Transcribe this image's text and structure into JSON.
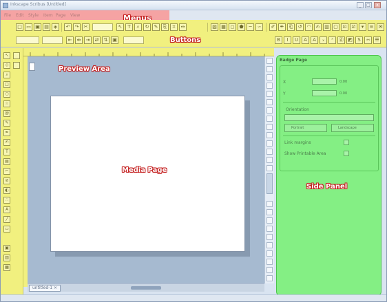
{
  "window": {
    "title": "Inkscape Scribus [Untitled]",
    "minimize": "_",
    "maximize": "□",
    "close": "x"
  },
  "menus": [
    "File",
    "Edit",
    "Style",
    "Item",
    "Page",
    "View"
  ],
  "annotations": {
    "menus": "Menus",
    "buttons": "Buttons",
    "preview_area": "Preview Area",
    "media_page": "Media Page",
    "side_panel": "Side Panel"
  },
  "side_panel": {
    "title": "Badge Page",
    "x_label": "X",
    "x_value": "0.00",
    "y_label": "Y",
    "y_value": "0.00",
    "orientation_label": "Orientation",
    "portrait_label": "Portrait",
    "landscape_label": "Landscape",
    "link_margins_label": "Link margins",
    "show_printable_label": "Show Printable Area"
  },
  "document_tab": {
    "label": "untitled-1 ×"
  },
  "colors": {
    "annotation_outline": "#c42020",
    "toolbar_highlight": "#f1f07f",
    "menu_highlight": "#f5a3a3",
    "side_panel_highlight": "#84ef84",
    "preview_background": "#a6bad0"
  }
}
